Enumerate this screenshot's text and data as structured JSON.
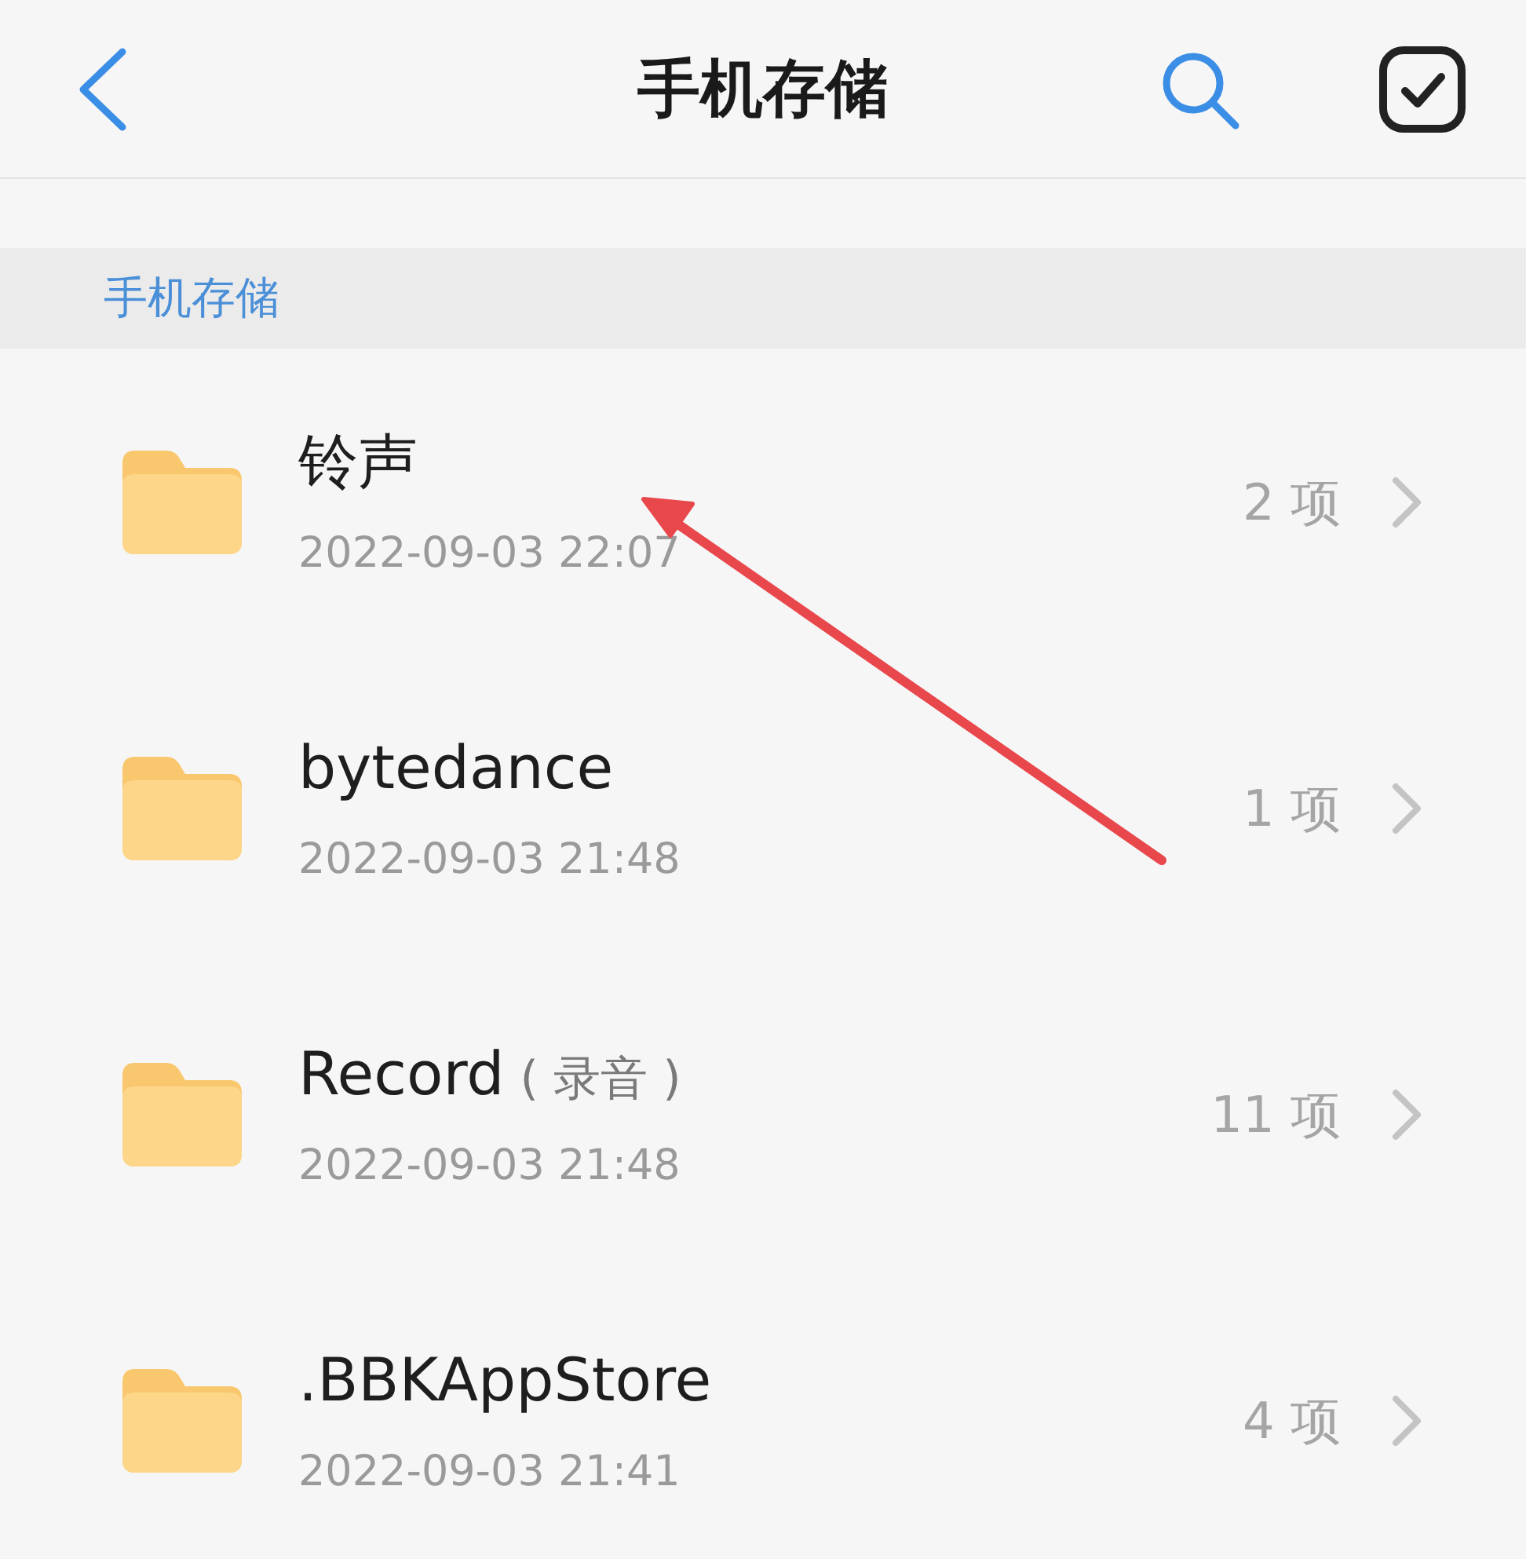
{
  "header": {
    "title": "手机存储"
  },
  "section": {
    "label": "手机存储"
  },
  "folders": [
    {
      "name": "铃声",
      "date": "2022-09-03 22:07",
      "count": "2 项"
    },
    {
      "name": "bytedance",
      "date": "2022-09-03 21:48",
      "count": "1 项"
    },
    {
      "name": "Record",
      "note": "( 录音 )",
      "date": "2022-09-03 21:48",
      "count": "11 项"
    },
    {
      "name": ".BBKAppStore",
      "date": "2022-09-03 21:41",
      "count": "4 项"
    }
  ]
}
